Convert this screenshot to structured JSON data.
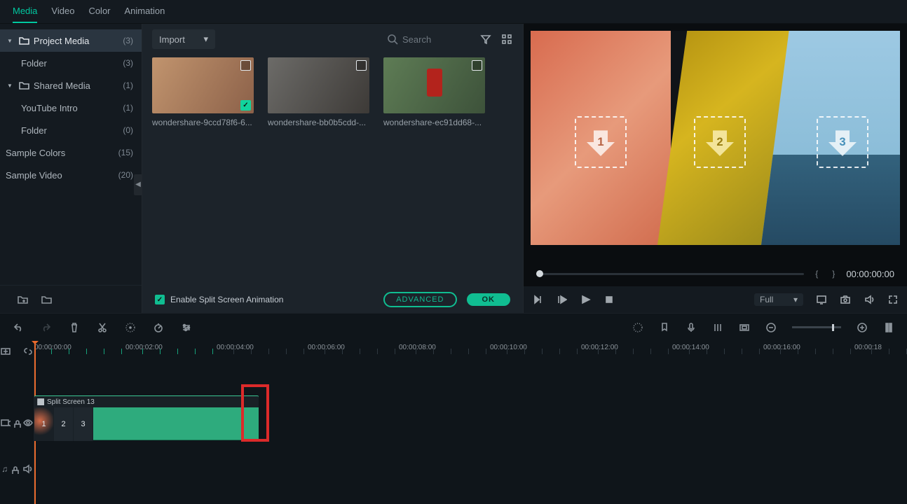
{
  "tabs": {
    "media": "Media",
    "video": "Video",
    "color": "Color",
    "animation": "Animation"
  },
  "side": {
    "projectMedia": {
      "label": "Project Media",
      "count": "(3)"
    },
    "folder1": {
      "label": "Folder",
      "count": "(3)"
    },
    "sharedMedia": {
      "label": "Shared Media",
      "count": "(1)"
    },
    "youtubeIntro": {
      "label": "YouTube Intro",
      "count": "(1)"
    },
    "folder2": {
      "label": "Folder",
      "count": "(0)"
    },
    "sampleColors": {
      "label": "Sample Colors",
      "count": "(15)"
    },
    "sampleVideo": {
      "label": "Sample Video",
      "count": "(20)"
    }
  },
  "mediabar": {
    "import": "Import",
    "searchPh": "Search"
  },
  "thumbs": {
    "a": "wondershare-9ccd78f6-6...",
    "b": "wondershare-bb0b5cdd-...",
    "c": "wondershare-ec91dd68-..."
  },
  "split": {
    "label": "Enable Split Screen Animation",
    "adv": "ADVANCED",
    "ok": "OK"
  },
  "preview": {
    "slots": [
      "1",
      "2",
      "3"
    ],
    "braces": "{",
    "braces2": "}",
    "time": "00:00:00:00",
    "full": "Full"
  },
  "ruler": [
    "00:00:00:00",
    "00:00:02:00",
    "00:00:04:00",
    "00:00:06:00",
    "00:00:08:00",
    "00:00:10:00",
    "00:00:12:00",
    "00:00:14:00",
    "00:00:16:00",
    "00:00:18"
  ],
  "clip": {
    "title": "Split Screen 13",
    "sections": [
      "1",
      "2",
      "3"
    ]
  },
  "glyph": {
    "caretDown": "▾",
    "triDown": "▼",
    "triLeft": "◀",
    "check": "✓",
    "folder": "🗀",
    "music": "♫"
  }
}
